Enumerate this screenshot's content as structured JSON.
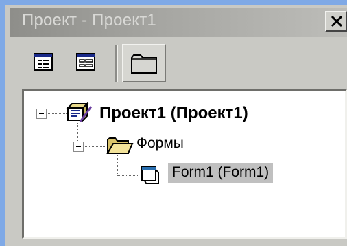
{
  "window": {
    "title": "Проект - Проект1",
    "close_glyph": "✕"
  },
  "toolbar": {
    "buttons": [
      {
        "name": "view-code-button",
        "icon": "view-code-icon"
      },
      {
        "name": "view-object-button",
        "icon": "view-object-icon"
      },
      {
        "name": "toggle-folders-button",
        "icon": "folder-icon",
        "pressed": true
      }
    ]
  },
  "tree": {
    "root": {
      "label": "Проект1 (Проект1)",
      "icon": "project-icon",
      "expanded": true
    },
    "folder": {
      "label": "Формы",
      "icon": "folder-open-icon",
      "expanded": true
    },
    "item": {
      "label": "Form1 (Form1)",
      "icon": "form-icon",
      "selected": true
    }
  },
  "colors": {
    "background": "#7fa9e6",
    "window": "#c9c9c4",
    "selection": "#c0c0c0"
  }
}
